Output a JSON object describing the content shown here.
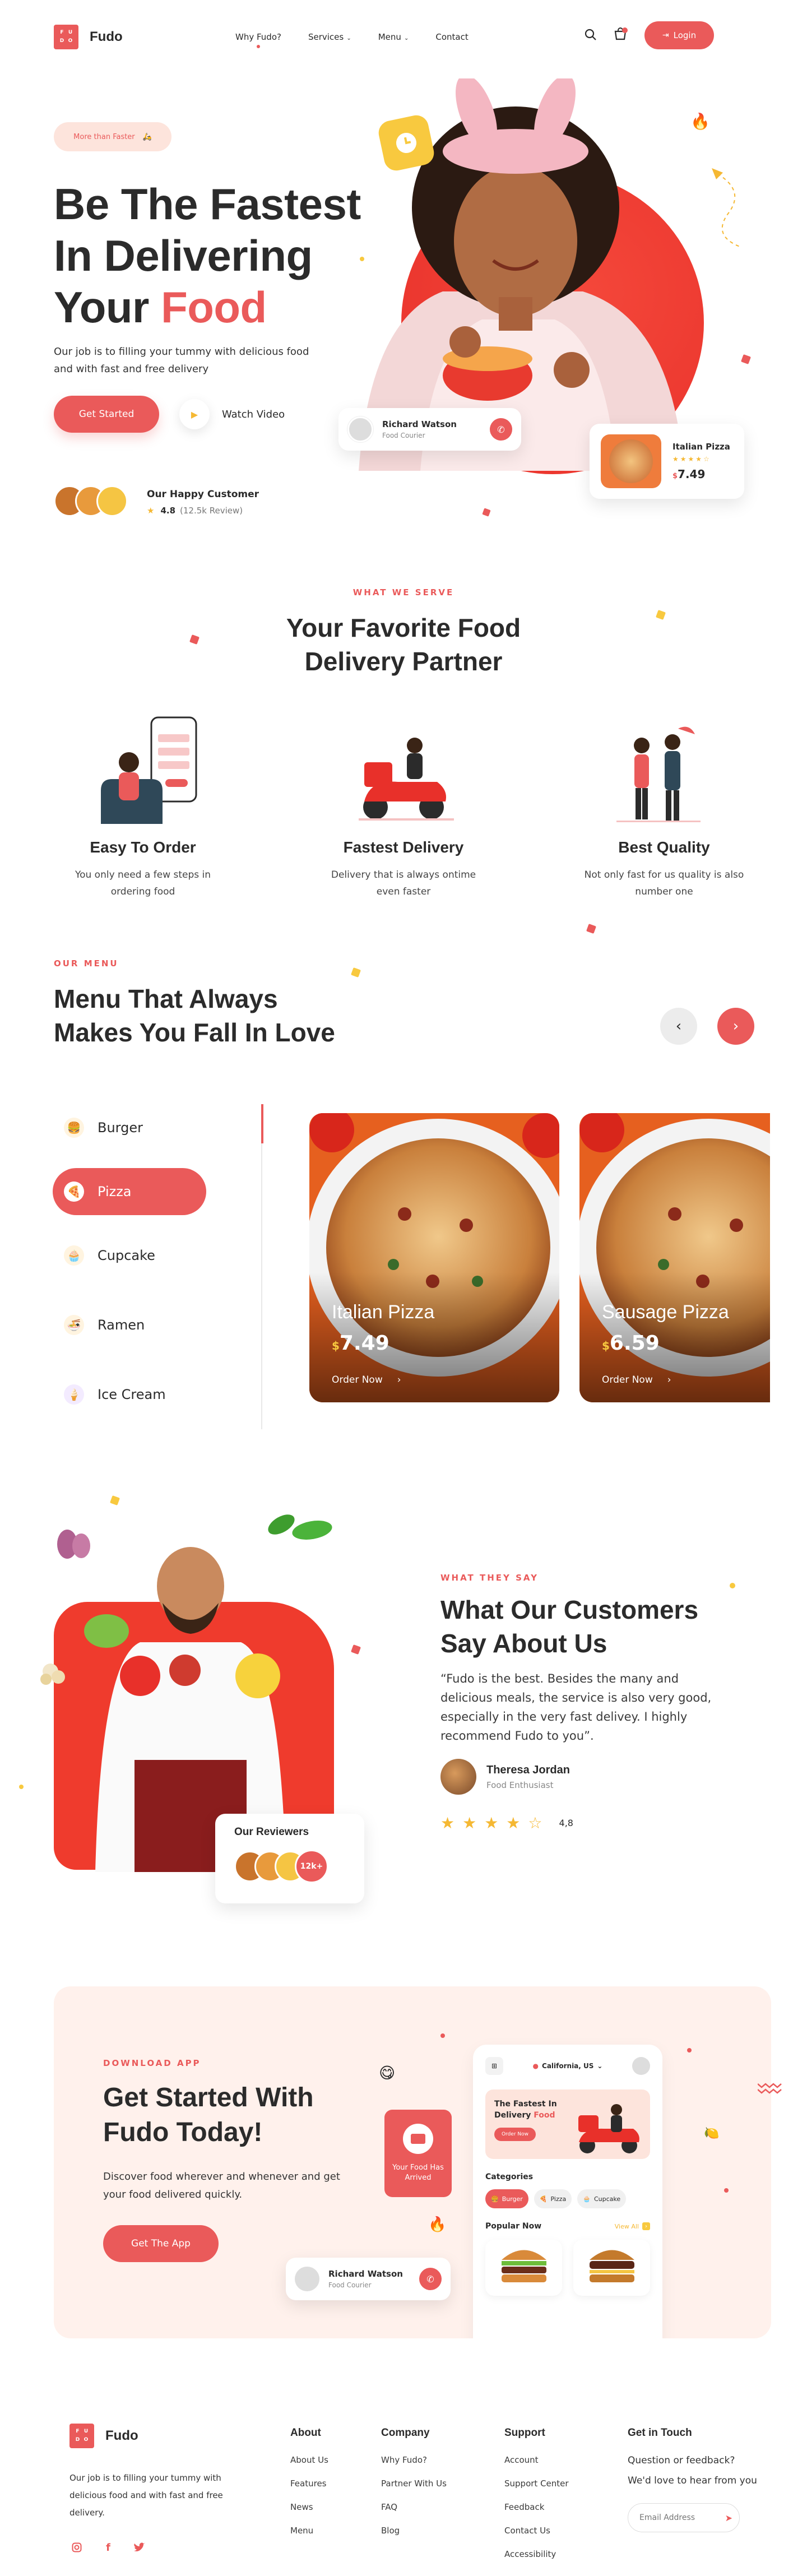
{
  "header": {
    "brand": "Fudo",
    "logo_letters": [
      "F",
      "U",
      "D",
      "O"
    ],
    "nav": [
      {
        "label": "Why Fudo?",
        "active": true
      },
      {
        "label": "Services",
        "dropdown": true
      },
      {
        "label": "Menu",
        "dropdown": true
      },
      {
        "label": "Contact"
      }
    ],
    "login_label": "Login",
    "cart_count": "",
    "accent": "#ea5a5a"
  },
  "hero": {
    "badge": "More than Faster",
    "title_line1": "Be The Fastest",
    "title_line2": "In Delivering",
    "title_line3a": "Your",
    "title_line3b": "Food",
    "description": "Our job is to filling your tummy with delicious food and  with fast and free delivery",
    "cta_primary": "Get Started",
    "cta_secondary": "Watch Video",
    "customers_label": "Our Happy Customer",
    "rating": "4.8",
    "reviews": "(12.5k Review)",
    "courier_name": "Richard Watson",
    "courier_role": "Food Courier",
    "product_name": "Italian Pizza",
    "product_price": "7.49",
    "product_currency": "$"
  },
  "serve": {
    "tag": "WHAT WE SERVE",
    "title_line1": "Your Favorite Food",
    "title_line2": "Delivery Partner",
    "features": [
      {
        "title": "Easy To Order",
        "desc_line1": "You only need a few steps in",
        "desc_line2": "ordering food"
      },
      {
        "title": "Fastest Delivery",
        "desc_line1": "Delivery that is always ontime",
        "desc_line2": "even faster"
      },
      {
        "title": "Best Quality",
        "desc_line1": "Not only fast for us quality is also",
        "desc_line2": "number one"
      }
    ]
  },
  "menu": {
    "tag": "OUR MENU",
    "title_line1": "Menu That Always",
    "title_line2": "Makes You Fall In Love",
    "categories": [
      {
        "label": "Burger",
        "icon": "burger-icon",
        "active": false
      },
      {
        "label": "Pizza",
        "icon": "pizza-icon",
        "active": true
      },
      {
        "label": "Cupcake",
        "icon": "cupcake-icon",
        "active": false
      },
      {
        "label": "Ramen",
        "icon": "ramen-icon",
        "active": false
      },
      {
        "label": "Ice Cream",
        "icon": "ice-cream-icon",
        "active": false
      }
    ],
    "cards": [
      {
        "name": "Italian Pizza",
        "currency": "$",
        "price": "7.49",
        "order": "Order Now"
      },
      {
        "name": "Sausage Pizza",
        "currency": "$",
        "price": "6.59",
        "order": "Order Now"
      }
    ]
  },
  "testimonial": {
    "tag": "WHAT THEY SAY",
    "title_line1": "What Our Customers",
    "title_line2": "Say About Us",
    "quote": "“Fudo is the best. Besides the many and delicious meals, the service is also very good, especially in the very  fast delivey. I highly recommend Fudo to you”.",
    "author": "Theresa Jordan",
    "author_role": "Food Enthusiast",
    "rating": "4,8",
    "reviewers_label": "Our Reviewers",
    "reviewers_count": "12k+"
  },
  "download": {
    "tag": "DOWNLOAD APP",
    "title_line1": "Get Started With",
    "title_line2": "Fudo Today!",
    "description": "Discover food wherever and whenever and get your food delivered quickly.",
    "cta": "Get The App",
    "notification": "Your Food Has Arrived",
    "courier_name": "Richard Watson",
    "courier_role": "Food Courier",
    "app": {
      "location": "California, US",
      "banner_line1": "The Fastest In",
      "banner_line2a": "Delivery",
      "banner_line2b": "Food",
      "banner_button": "Order Now",
      "categories_label": "Categories",
      "chips": [
        "Burger",
        "Pizza",
        "Cupcake"
      ],
      "popular_label": "Popular Now",
      "view_all": "View All"
    }
  },
  "footer": {
    "brand": "Fudo",
    "description": "Our job is to filling your tummy with delicious food and  with fast and free delivery.",
    "columns": [
      {
        "title": "About",
        "links": [
          "About Us",
          "Features",
          "News",
          "Menu"
        ]
      },
      {
        "title": "Company",
        "links": [
          "Why Fudo?",
          "Partner With Us",
          "FAQ",
          "Blog"
        ]
      },
      {
        "title": "Support",
        "links": [
          "Account",
          "Support Center",
          "Feedback",
          "Contact Us",
          "Accessibility"
        ]
      }
    ],
    "contact_title": "Get in Touch",
    "contact_line1": "Question or feedback?",
    "contact_line2": "We'd love to hear from you",
    "email_placeholder": "Email Address",
    "social": [
      "instagram-icon",
      "facebook-icon",
      "twitter-icon"
    ]
  }
}
